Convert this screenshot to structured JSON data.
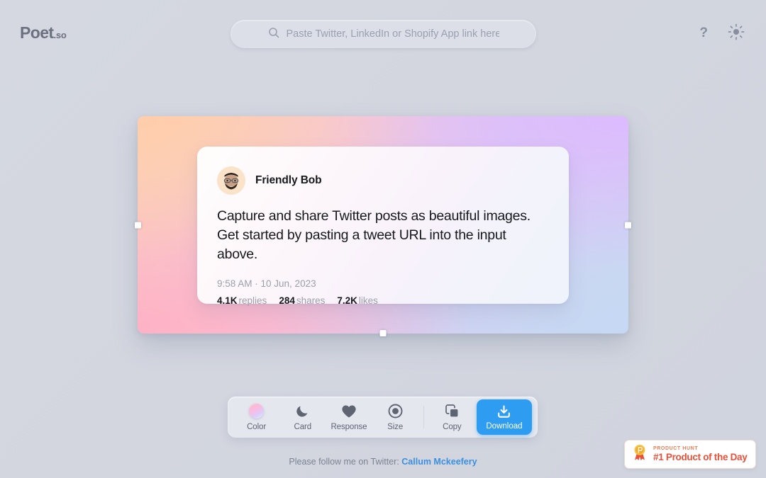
{
  "app": {
    "logo_main": "Poet",
    "logo_suffix": ".so",
    "background_color": "#d4d7e0"
  },
  "search": {
    "placeholder": "Paste Twitter, LinkedIn or Shopify App link here",
    "value": "",
    "icon": "search-icon"
  },
  "top_actions": {
    "help_label": "?",
    "help_icon": "question-mark-icon",
    "theme_icon": "sun-icon"
  },
  "tweet": {
    "author_name": "Friendly Bob",
    "avatar_icon": "memoji-avatar",
    "body": "Capture and share Twitter posts as beautiful images. Get started by pasting a tweet URL into the input above.",
    "timestamp": "9:58 AM · 10 Jun, 2023",
    "stats": [
      {
        "value": "4.1K",
        "label": "replies"
      },
      {
        "value": "284",
        "label": "shares"
      },
      {
        "value": "7.2K",
        "label": "likes"
      }
    ]
  },
  "canvas": {
    "gradient_colors": [
      "#fbd0bb",
      "#f4c6dd",
      "#dcc9f2",
      "#ccd9f1"
    ],
    "handles": [
      "handle-left",
      "handle-right",
      "handle-bottom"
    ]
  },
  "toolbar": {
    "tools": [
      {
        "label": "Color",
        "icon": "color-gradient-swatch-icon"
      },
      {
        "label": "Card",
        "icon": "moon-icon"
      },
      {
        "label": "Response",
        "icon": "heart-icon"
      },
      {
        "label": "Size",
        "icon": "target-circle-icon"
      },
      {
        "label": "Copy",
        "icon": "copy-icon"
      }
    ],
    "download": {
      "label": "Download",
      "icon": "download-icon",
      "color": "#2e9cf0"
    }
  },
  "footer": {
    "text": "Please follow me on Twitter:",
    "link_text": "Callum Mckeefery",
    "link_color": "#3b8fe0"
  },
  "product_hunt": {
    "kicker": "PRODUCT HUNT",
    "title": "#1 Product of the Day",
    "icon": "medal-icon",
    "accent_color": "#e8503a"
  }
}
